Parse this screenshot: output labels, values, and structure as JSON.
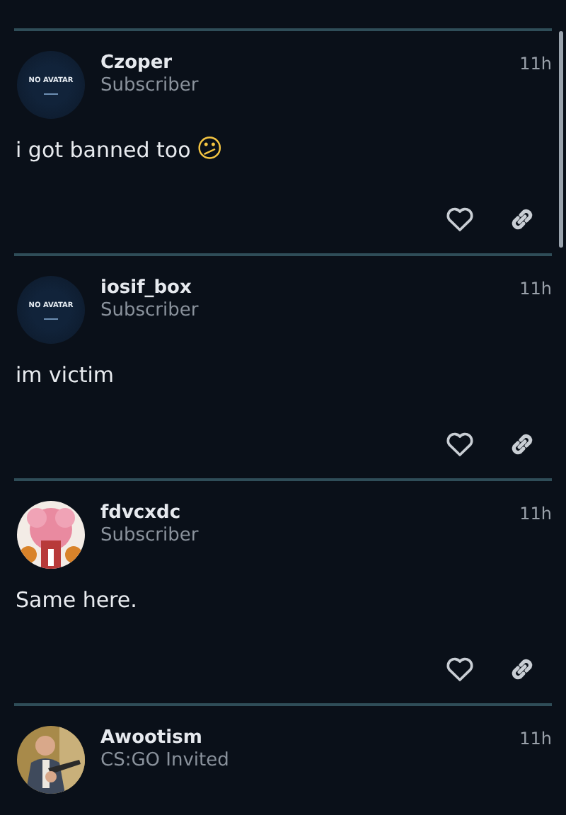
{
  "posts": [
    {
      "author": "Czoper",
      "role": "Subscriber",
      "time": "11h",
      "avatar": {
        "kind": "placeholder",
        "text": "NO AVATAR"
      },
      "body": "i got banned too",
      "emoji": "😕",
      "actions": true
    },
    {
      "author": "iosif_box",
      "role": "Subscriber",
      "time": "11h",
      "avatar": {
        "kind": "placeholder",
        "text": "NO AVATAR"
      },
      "body": "im victim",
      "actions": true
    },
    {
      "author": "fdvcxdc",
      "role": "Subscriber",
      "time": "11h",
      "body": "Same here.",
      "actions": true
    },
    {
      "author": "Awootism",
      "role": "CS:GO Invited",
      "time": "11h"
    }
  ]
}
